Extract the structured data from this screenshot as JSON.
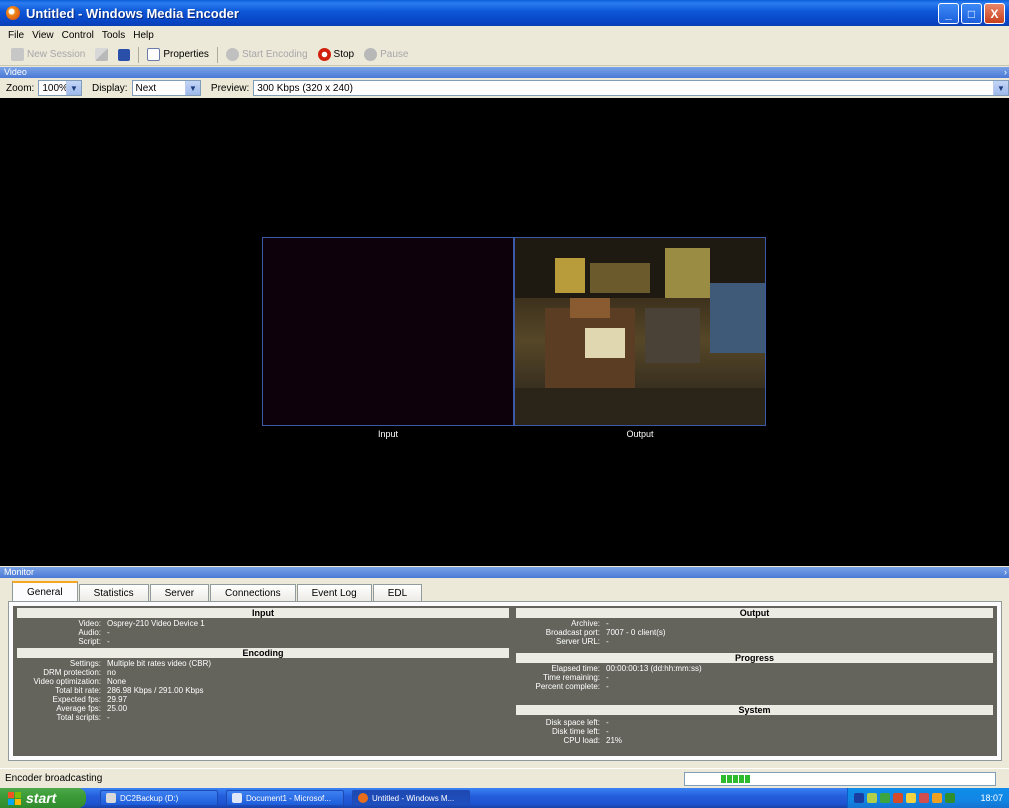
{
  "window": {
    "title": "Untitled - Windows Media Encoder",
    "controls": {
      "minimize": "_",
      "maximize": "□",
      "close": "X"
    }
  },
  "menu": [
    "File",
    "View",
    "Control",
    "Tools",
    "Help"
  ],
  "toolbar": {
    "new_session": "New Session",
    "properties": "Properties",
    "start_encoding": "Start Encoding",
    "stop": "Stop",
    "pause": "Pause"
  },
  "video_pane": {
    "header": "Video",
    "zoom_label": "Zoom:",
    "zoom_value": "100%",
    "display_label": "Display:",
    "display_value": "Next",
    "preview_label": "Preview:",
    "preview_value": "300 Kbps (320 x 240)",
    "input_caption": "Input",
    "output_caption": "Output"
  },
  "monitor": {
    "header": "Monitor",
    "tabs": [
      "General",
      "Statistics",
      "Server",
      "Connections",
      "Event Log",
      "EDL"
    ],
    "active_tab": "General",
    "input": {
      "title": "Input",
      "rows": [
        {
          "label": "Video:",
          "value": "Osprey-210 Video Device 1"
        },
        {
          "label": "Audio:",
          "value": "-"
        },
        {
          "label": "Script:",
          "value": "-"
        }
      ]
    },
    "encoding": {
      "title": "Encoding",
      "rows": [
        {
          "label": "Settings:",
          "value": "Multiple bit rates video (CBR)"
        },
        {
          "label": "DRM protection:",
          "value": "no"
        },
        {
          "label": "Video optimization:",
          "value": "None"
        },
        {
          "label": "Total bit rate:",
          "value": "286.98 Kbps / 291.00 Kbps"
        },
        {
          "label": "Expected fps:",
          "value": "29.97"
        },
        {
          "label": "Average fps:",
          "value": "25.00"
        },
        {
          "label": "Total scripts:",
          "value": "-"
        }
      ]
    },
    "output": {
      "title": "Output",
      "rows": [
        {
          "label": "Archive:",
          "value": "-"
        },
        {
          "label": "Broadcast port:",
          "value": "7007 - 0 client(s)"
        },
        {
          "label": "Server URL:",
          "value": "-"
        }
      ]
    },
    "progress": {
      "title": "Progress",
      "rows": [
        {
          "label": "Elapsed time:",
          "value": "00:00:00:13  (dd:hh:mm:ss)"
        },
        {
          "label": "Time remaining:",
          "value": "-"
        },
        {
          "label": "Percent complete:",
          "value": "-"
        }
      ]
    },
    "system": {
      "title": "System",
      "rows": [
        {
          "label": "Disk space left:",
          "value": "-"
        },
        {
          "label": "Disk time left:",
          "value": "-"
        },
        {
          "label": "CPU load:",
          "value": "21%"
        }
      ]
    }
  },
  "status": {
    "text": "Encoder broadcasting"
  },
  "taskbar": {
    "start": "start",
    "buttons": [
      "DC2Backup (D:)",
      "Document1 - Microsof...",
      "Untitled - Windows M..."
    ],
    "clock": "18:07"
  }
}
